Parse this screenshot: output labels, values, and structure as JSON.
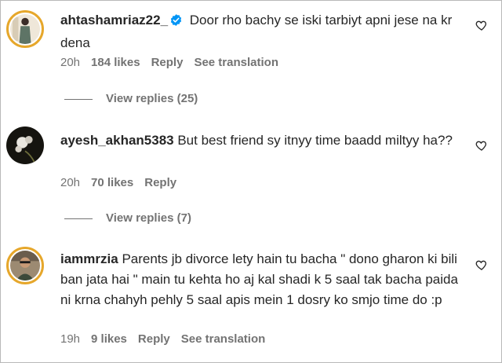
{
  "comments": [
    {
      "username": "ahtashamriaz22_",
      "verified": true,
      "text": "Door rho bachy se iski tarbiyt apni jese na kr dena",
      "time": "20h",
      "likes": "184 likes",
      "reply_label": "Reply",
      "translate_label": "See translation",
      "view_replies": "View replies (25)"
    },
    {
      "username": "ayesh_akhan5383",
      "verified": false,
      "text": "But best friend sy itnyy time baadd miltyy ha??",
      "time": "20h",
      "likes": "70 likes",
      "reply_label": "Reply",
      "view_replies": "View replies (7)"
    },
    {
      "username": "iammrzia",
      "verified": false,
      "text": "Parents jb divorce lety hain tu bacha \" dono gharon ki bili ban jata hai \" main tu kehta ho aj kal shadi k 5 saal tak bacha paida ni krna chahyh pehly 5 saal apis mein 1 dosry ko smjo time do :p",
      "time": "19h",
      "likes": "9 likes",
      "reply_label": "Reply",
      "translate_label": "See translation"
    }
  ],
  "icons": {
    "like": "heart-outline-icon",
    "verified": "verified-badge-icon"
  },
  "colors": {
    "verified_blue": "#0095f6",
    "story_ring": "#e6a72b",
    "meta_gray": "#737373"
  }
}
